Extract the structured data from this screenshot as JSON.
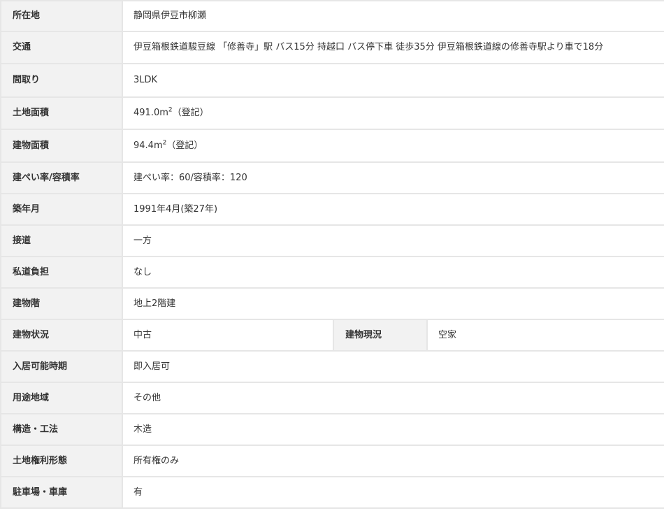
{
  "rows": [
    {
      "label": "所在地",
      "value": "静岡県伊豆市柳瀬"
    },
    {
      "label": "交通",
      "value": "伊豆箱根鉄道駿豆線 「修善寺」駅 バス15分 持越口 バス停下車 徒歩35分 伊豆箱根鉄道線の修善寺駅より車で18分"
    },
    {
      "label": "間取り",
      "value": "3LDK"
    },
    {
      "label": "土地面積",
      "value": "491.0m",
      "sup": "2",
      "suffix": "（登記）"
    },
    {
      "label": "建物面積",
      "value": "94.4m",
      "sup": "2",
      "suffix": "（登記）"
    },
    {
      "label": "建ぺい率/容積率",
      "value": "建ぺい率：60/容積率：120"
    },
    {
      "label": "築年月",
      "value": "1991年4月(築27年)"
    },
    {
      "label": "接道",
      "value": "一方"
    },
    {
      "label": "私道負担",
      "value": "なし"
    },
    {
      "label": "建物階",
      "value": "地上2階建"
    },
    {
      "label": "建物状況",
      "value": "中古",
      "label2": "建物現況",
      "value2": "空家"
    },
    {
      "label": "入居可能時期",
      "value": "即入居可"
    },
    {
      "label": "用途地域",
      "value": "その他"
    },
    {
      "label": "構造・工法",
      "value": "木造"
    },
    {
      "label": "土地権利形態",
      "value": "所有権のみ"
    },
    {
      "label": "駐車場・車庫",
      "value": "有"
    }
  ]
}
